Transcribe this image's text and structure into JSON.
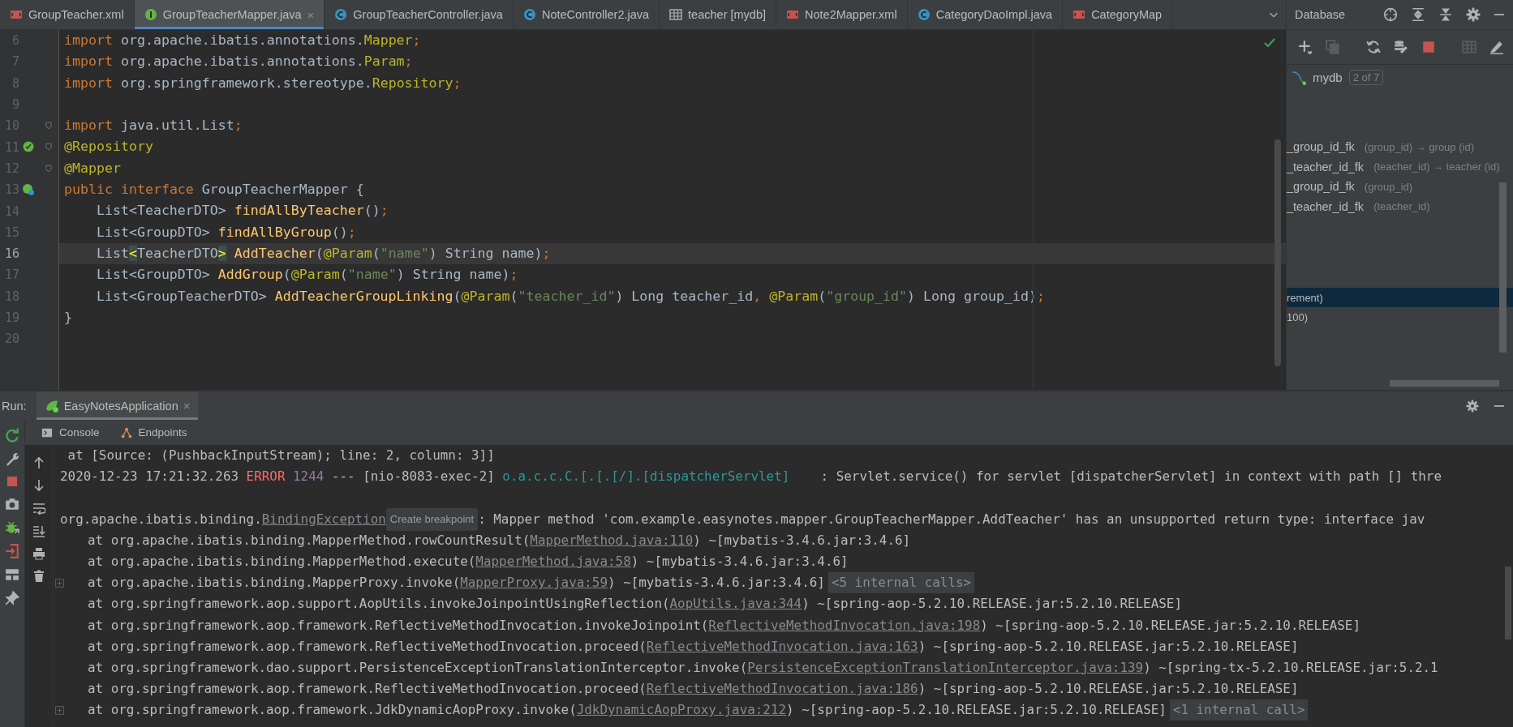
{
  "editor_tabs": [
    {
      "label": "GroupTeacher.xml",
      "kind": "xml",
      "selected": false
    },
    {
      "label": "GroupTeacherMapper.java",
      "kind": "interface",
      "selected": true,
      "close": "×"
    },
    {
      "label": "GroupTeacherController.java",
      "kind": "class",
      "selected": false
    },
    {
      "label": "NoteController2.java",
      "kind": "class",
      "selected": false
    },
    {
      "label": "teacher [mydb]",
      "kind": "table",
      "selected": false
    },
    {
      "label": "Note2Mapper.xml",
      "kind": "xml",
      "selected": false
    },
    {
      "label": "CategoryDaoImpl.java",
      "kind": "class",
      "selected": false
    },
    {
      "label": "CategoryMap",
      "kind": "xml",
      "selected": false
    }
  ],
  "editor": {
    "lines": [
      {
        "number": "6",
        "current": false,
        "fold": false,
        "tokens": [
          {
            "text": "import",
            "kind": "keyword"
          },
          {
            "text": " org.apache.ibatis.annotations.",
            "kind": "plain"
          },
          {
            "text": "Mapper",
            "kind": "annotation"
          },
          {
            "text": ";",
            "kind": "keyword"
          }
        ]
      },
      {
        "number": "7",
        "current": false,
        "fold": false,
        "tokens": [
          {
            "text": "import",
            "kind": "keyword"
          },
          {
            "text": " org.apache.ibatis.annotations.",
            "kind": "plain"
          },
          {
            "text": "Param",
            "kind": "annotation"
          },
          {
            "text": ";",
            "kind": "keyword"
          }
        ]
      },
      {
        "number": "8",
        "current": false,
        "fold": false,
        "tokens": [
          {
            "text": "import",
            "kind": "keyword"
          },
          {
            "text": " org.springframework.stereotype.",
            "kind": "plain"
          },
          {
            "text": "Repository",
            "kind": "annotation"
          },
          {
            "text": ";",
            "kind": "keyword"
          }
        ]
      },
      {
        "number": "9",
        "current": false,
        "fold": false
      },
      {
        "number": "10",
        "current": false,
        "fold": true,
        "tokens": [
          {
            "text": "import",
            "kind": "keyword"
          },
          {
            "text": " java.util.List",
            "kind": "plain"
          },
          {
            "text": ";",
            "kind": "keyword"
          }
        ]
      },
      {
        "number": "11",
        "current": false,
        "fold": true,
        "kind": "bean",
        "tokens": [
          {
            "text": "@Repository",
            "kind": "annotation"
          }
        ]
      },
      {
        "number": "12",
        "current": false,
        "fold": true,
        "tokens": [
          {
            "text": "@Mapper",
            "kind": "annotation"
          }
        ]
      },
      {
        "number": "13",
        "current": false,
        "fold": false,
        "kind": "implemented",
        "tokens": [
          {
            "text": "public ",
            "kind": "keyword"
          },
          {
            "text": "interface",
            "kind": "keyword"
          },
          {
            "text": " GroupTeacherMapper {",
            "kind": "plain"
          }
        ]
      },
      {
        "number": "14",
        "current": false,
        "fold": false,
        "tokens": [
          {
            "text": "    List<TeacherDTO> ",
            "kind": "plain"
          },
          {
            "text": "findAllByTeacher",
            "kind": "method"
          },
          {
            "text": "()",
            "kind": "plain"
          },
          {
            "text": ";",
            "kind": "keyword"
          }
        ]
      },
      {
        "number": "15",
        "current": false,
        "fold": false,
        "tokens": [
          {
            "text": "    List<GroupDTO> ",
            "kind": "plain"
          },
          {
            "text": "findAllByGroup",
            "kind": "method"
          },
          {
            "text": "()",
            "kind": "plain"
          },
          {
            "text": ";",
            "kind": "keyword"
          }
        ]
      },
      {
        "number": "16",
        "current": true,
        "fold": false,
        "tokens": [
          {
            "text": "    List",
            "kind": "plain"
          },
          {
            "text": "<",
            "kind": "match"
          },
          {
            "text": "TeacherDTO",
            "kind": "plain"
          },
          {
            "text": ">",
            "kind": "match"
          },
          {
            "text": " AddTeacher",
            "kind": "method"
          },
          {
            "text": "(",
            "kind": "plain"
          },
          {
            "text": "@Param",
            "kind": "annotation"
          },
          {
            "text": "(",
            "kind": "plain"
          },
          {
            "text": "\"name\"",
            "kind": "string"
          },
          {
            "text": ") String name)",
            "kind": "plain"
          },
          {
            "text": ";",
            "kind": "keyword"
          }
        ]
      },
      {
        "number": "17",
        "current": false,
        "fold": false,
        "tokens": [
          {
            "text": "    List<GroupDTO> ",
            "kind": "plain"
          },
          {
            "text": "AddGroup",
            "kind": "method"
          },
          {
            "text": "(",
            "kind": "plain"
          },
          {
            "text": "@Param",
            "kind": "annotation"
          },
          {
            "text": "(",
            "kind": "plain"
          },
          {
            "text": "\"name\"",
            "kind": "string"
          },
          {
            "text": ") String name)",
            "kind": "plain"
          },
          {
            "text": ";",
            "kind": "keyword"
          }
        ]
      },
      {
        "number": "18",
        "current": false,
        "fold": false,
        "tokens": [
          {
            "text": "    List<GroupTeacherDTO> ",
            "kind": "plain"
          },
          {
            "text": "AddTeacherGroupLinking",
            "kind": "method"
          },
          {
            "text": "(",
            "kind": "plain"
          },
          {
            "text": "@Param",
            "kind": "annotation"
          },
          {
            "text": "(",
            "kind": "plain"
          },
          {
            "text": "\"teacher_id\"",
            "kind": "string"
          },
          {
            "text": ") Long teacher_id",
            "kind": "plain"
          },
          {
            "text": ", ",
            "kind": "keyword"
          },
          {
            "text": "@Param",
            "kind": "annotation"
          },
          {
            "text": "(",
            "kind": "plain"
          },
          {
            "text": "\"group_id\"",
            "kind": "string"
          },
          {
            "text": ") Long group_id)",
            "kind": "plain"
          },
          {
            "text": ";",
            "kind": "keyword"
          }
        ]
      },
      {
        "number": "19",
        "current": false,
        "fold": false,
        "tokens": [
          {
            "text": "}",
            "kind": "plain"
          }
        ]
      },
      {
        "number": "20",
        "current": false,
        "fold": false
      }
    ]
  },
  "database": {
    "title": "Database",
    "connection": {
      "name": "mydb",
      "badge": "2 of 7"
    },
    "items": [
      {
        "name": "_group_id_fk",
        "detail": "(group_id) → group (id)",
        "selected": false
      },
      {
        "name": "_teacher_id_fk",
        "detail": "(teacher_id) → teacher (id)",
        "selected": false
      },
      {
        "name": "_group_id_fk",
        "detail": "(group_id)",
        "selected": false
      },
      {
        "name": "_teacher_id_fk",
        "detail": "(teacher_id)",
        "selected": false
      }
    ],
    "columns": [
      {
        "text": "rement)",
        "selected": true
      },
      {
        "text": "100)",
        "selected": false
      }
    ]
  },
  "run": {
    "label": "Run:",
    "tab": {
      "label": "EasyNotesApplication",
      "close": "×"
    },
    "subtabs": [
      {
        "label": "Console",
        "kind": "console"
      },
      {
        "label": "Endpoints",
        "kind": "endpoints"
      }
    ],
    "console": [
      {
        "kind": "message",
        "expandable": false,
        "segments": [
          {
            "text": " at [Source: (PushbackInputStream); line: 2, column: 3]]",
            "kind": "plain"
          }
        ]
      },
      {
        "kind": "message",
        "expandable": false,
        "segments": [
          {
            "text": "2020-12-23 17:21:32.263 ",
            "kind": "plain"
          },
          {
            "text": "ERROR ",
            "kind": "error"
          },
          {
            "text": "1244",
            "kind": "pid"
          },
          {
            "text": " --- [nio-8083-exec-2] ",
            "kind": "plain"
          },
          {
            "text": "o.a.c.c.C.[.[.[/].[dispatcherServlet]",
            "kind": "logger"
          },
          {
            "text": "    : Servlet.service() for servlet [dispatcherServlet] in context with path [] thre",
            "kind": "plain"
          }
        ]
      },
      {
        "kind": "blank"
      },
      {
        "kind": "message",
        "expandable": false,
        "segments": [
          {
            "text": "org.apache.ibatis.binding.",
            "kind": "plain"
          },
          {
            "text": "BindingException",
            "kind": "link"
          },
          {
            "text": "Create breakpoint",
            "kind": "hint"
          },
          {
            "text": ": Mapper method 'com.example.easynotes.mapper.GroupTeacherMapper.AddTeacher' has an unsupported return type: interface jav",
            "kind": "plain"
          }
        ]
      },
      {
        "kind": "frame",
        "expandable": false,
        "segments": [
          {
            "text": "at org.apache.ibatis.binding.MapperMethod.rowCountResult(",
            "kind": "plain"
          },
          {
            "text": "MapperMethod.java:110",
            "kind": "link"
          },
          {
            "text": ") ~[mybatis-3.4.6.jar:3.4.6]",
            "kind": "plain"
          }
        ]
      },
      {
        "kind": "frame",
        "expandable": false,
        "segments": [
          {
            "text": "at org.apache.ibatis.binding.MapperMethod.execute(",
            "kind": "plain"
          },
          {
            "text": "MapperMethod.java:58",
            "kind": "link"
          },
          {
            "text": ") ~[mybatis-3.4.6.jar:3.4.6]",
            "kind": "plain"
          }
        ]
      },
      {
        "kind": "frame",
        "expandable": true,
        "segments": [
          {
            "text": "at org.apache.ibatis.binding.MapperProxy.invoke(",
            "kind": "plain"
          },
          {
            "text": "MapperProxy.java:59",
            "kind": "link"
          },
          {
            "text": ") ~[mybatis-3.4.6.jar:3.4.6]",
            "kind": "plain"
          },
          {
            "text": "<5 internal calls>",
            "kind": "folded"
          }
        ]
      },
      {
        "kind": "frame",
        "expandable": false,
        "segments": [
          {
            "text": "at org.springframework.aop.support.AopUtils.invokeJoinpointUsingReflection(",
            "kind": "plain"
          },
          {
            "text": "AopUtils.java:344",
            "kind": "link"
          },
          {
            "text": ") ~[spring-aop-5.2.10.RELEASE.jar:5.2.10.RELEASE]",
            "kind": "plain"
          }
        ]
      },
      {
        "kind": "frame",
        "expandable": false,
        "segments": [
          {
            "text": "at org.springframework.aop.framework.ReflectiveMethodInvocation.invokeJoinpoint(",
            "kind": "plain"
          },
          {
            "text": "ReflectiveMethodInvocation.java:198",
            "kind": "link"
          },
          {
            "text": ") ~[spring-aop-5.2.10.RELEASE.jar:5.2.10.RELEASE]",
            "kind": "plain"
          }
        ]
      },
      {
        "kind": "frame",
        "expandable": false,
        "segments": [
          {
            "text": "at org.springframework.aop.framework.ReflectiveMethodInvocation.proceed(",
            "kind": "plain"
          },
          {
            "text": "ReflectiveMethodInvocation.java:163",
            "kind": "link"
          },
          {
            "text": ") ~[spring-aop-5.2.10.RELEASE.jar:5.2.10.RELEASE]",
            "kind": "plain"
          }
        ]
      },
      {
        "kind": "frame",
        "expandable": false,
        "segments": [
          {
            "text": "at org.springframework.dao.support.PersistenceExceptionTranslationInterceptor.invoke(",
            "kind": "plain"
          },
          {
            "text": "PersistenceExceptionTranslationInterceptor.java:139",
            "kind": "link"
          },
          {
            "text": ") ~[spring-tx-5.2.10.RELEASE.jar:5.2.1",
            "kind": "plain"
          }
        ]
      },
      {
        "kind": "frame",
        "expandable": false,
        "segments": [
          {
            "text": "at org.springframework.aop.framework.ReflectiveMethodInvocation.proceed(",
            "kind": "plain"
          },
          {
            "text": "ReflectiveMethodInvocation.java:186",
            "kind": "link"
          },
          {
            "text": ") ~[spring-aop-5.2.10.RELEASE.jar:5.2.10.RELEASE]",
            "kind": "plain"
          }
        ]
      },
      {
        "kind": "frame",
        "expandable": true,
        "segments": [
          {
            "text": "at org.springframework.aop.framework.JdkDynamicAopProxy.invoke(",
            "kind": "plain"
          },
          {
            "text": "JdkDynamicAopProxy.java:212",
            "kind": "link"
          },
          {
            "text": ") ~[spring-aop-5.2.10.RELEASE.jar:5.2.10.RELEASE]",
            "kind": "plain"
          },
          {
            "text": "<1 internal call>",
            "kind": "folded"
          }
        ]
      }
    ]
  }
}
